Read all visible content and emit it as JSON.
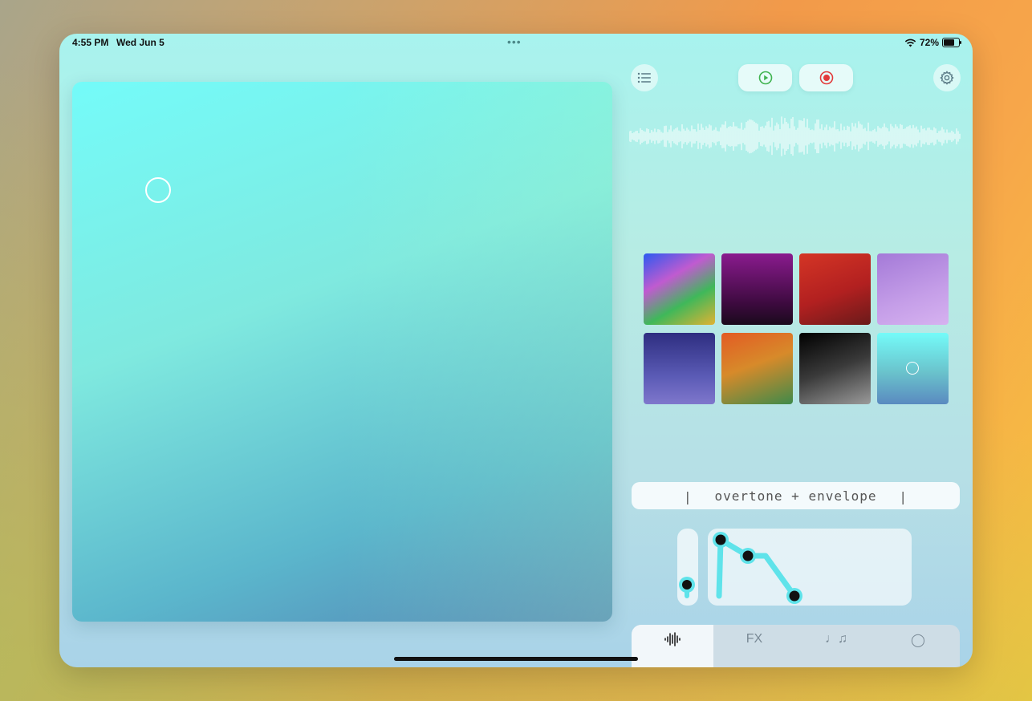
{
  "status": {
    "time": "4:55 PM",
    "date": "Wed Jun 5",
    "battery": "72%",
    "battery_level": 0.72,
    "multitask_dots": "•••"
  },
  "toolbar": {
    "menu_icon": "list-icon",
    "play_icon": "play-circle-icon",
    "record_icon": "record-circle-icon",
    "settings_icon": "gear-icon",
    "play_color": "#3fb34f",
    "record_color": "#e23a3a"
  },
  "presets": [
    {
      "name": "rainbow",
      "gradient": "linear-gradient(150deg,#2c5af0 0%,#c05bd0 35%,#3fb85a 65%,#e0b233 100%)"
    },
    {
      "name": "purple-black",
      "gradient": "linear-gradient(180deg,#8a1b8e 0%,#3d0a3f 70%,#1a0a1c 100%)"
    },
    {
      "name": "red",
      "gradient": "linear-gradient(160deg,#d43525 0%,#b22020 55%,#6a1a1a 100%)"
    },
    {
      "name": "lavender",
      "gradient": "linear-gradient(160deg,#a47ad8 0%,#c59ee8 60%,#d6b2f0 100%)"
    },
    {
      "name": "indigo",
      "gradient": "linear-gradient(180deg,#2e2e80 0%,#5a5ab5 60%,#7f77cc 100%)"
    },
    {
      "name": "orange-green",
      "gradient": "linear-gradient(160deg,#e35b24 0%,#d78a2a 45%,#3f8a4a 100%)"
    },
    {
      "name": "black-gray",
      "gradient": "linear-gradient(160deg,#000000 0%,#3a3a3a 50%,#9a9a9a 100%)"
    },
    {
      "name": "cyan-blue",
      "gradient": "linear-gradient(180deg,#74fbf9 0%,#6ac3cc 55%,#5a8ac0 100%)",
      "selected": true
    }
  ],
  "section": {
    "label": "overtone + envelope",
    "left_bar": "|",
    "right_bar": "|"
  },
  "envelope": {
    "accent_color": "#5fe3ea",
    "point_color": "#111111"
  },
  "tabs": [
    {
      "name": "tab-sound",
      "label": "",
      "icon": "waveform-icon",
      "active": true
    },
    {
      "name": "tab-fx",
      "label": "FX",
      "icon": "",
      "active": false
    },
    {
      "name": "tab-notes",
      "label": "♩♫",
      "icon": "music-notes-icon",
      "active": false
    },
    {
      "name": "tab-circle",
      "label": "◯",
      "icon": "circle-icon",
      "active": false
    }
  ]
}
